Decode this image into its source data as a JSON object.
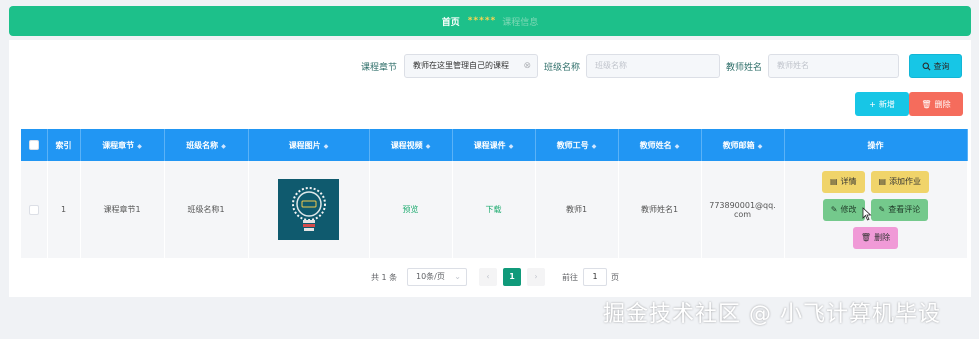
{
  "header": {
    "home": "首页",
    "separator": "*****",
    "current": "课程信息"
  },
  "search": {
    "chapter_label": "课程章节",
    "chapter_value": "教师在这里管理自己的课程",
    "class_label": "班级名称",
    "class_placeholder": "班级名称",
    "teacher_label": "教师姓名",
    "teacher_placeholder": "教师姓名",
    "query_button": "查询"
  },
  "actions": {
    "add_button": "新增",
    "delete_button": "删除"
  },
  "table": {
    "headers": [
      "",
      "索引",
      "课程章节",
      "班级名称",
      "课程图片",
      "课程视频",
      "课程课件",
      "教师工号",
      "教师姓名",
      "教师邮箱",
      "操作"
    ],
    "rows": [
      {
        "index": "1",
        "chapter": "课程章节1",
        "class_name": "班级名称1",
        "video": "预览",
        "courseware": "下载",
        "teacher_id": "教师1",
        "teacher_name": "教师姓名1",
        "email_line1": "773890001@qq.",
        "email_line2": "com",
        "ops": {
          "detail": "详情",
          "add_homework": "添加作业",
          "edit": "修改",
          "view_comments": "查看评论",
          "delete": "删除"
        }
      }
    ]
  },
  "pagination": {
    "total": "共 1 条",
    "page_size": "10条/页",
    "current_page": "1",
    "goto_label": "前往",
    "goto_value": "1",
    "goto_unit": "页"
  },
  "watermark": "掘金技术社区 @ 小飞计算机毕设",
  "colors": {
    "header_green": "#1dc08a",
    "table_header_blue": "#2196f3",
    "accent_cyan": "#17c6e6",
    "danger": "#f56c5c"
  }
}
